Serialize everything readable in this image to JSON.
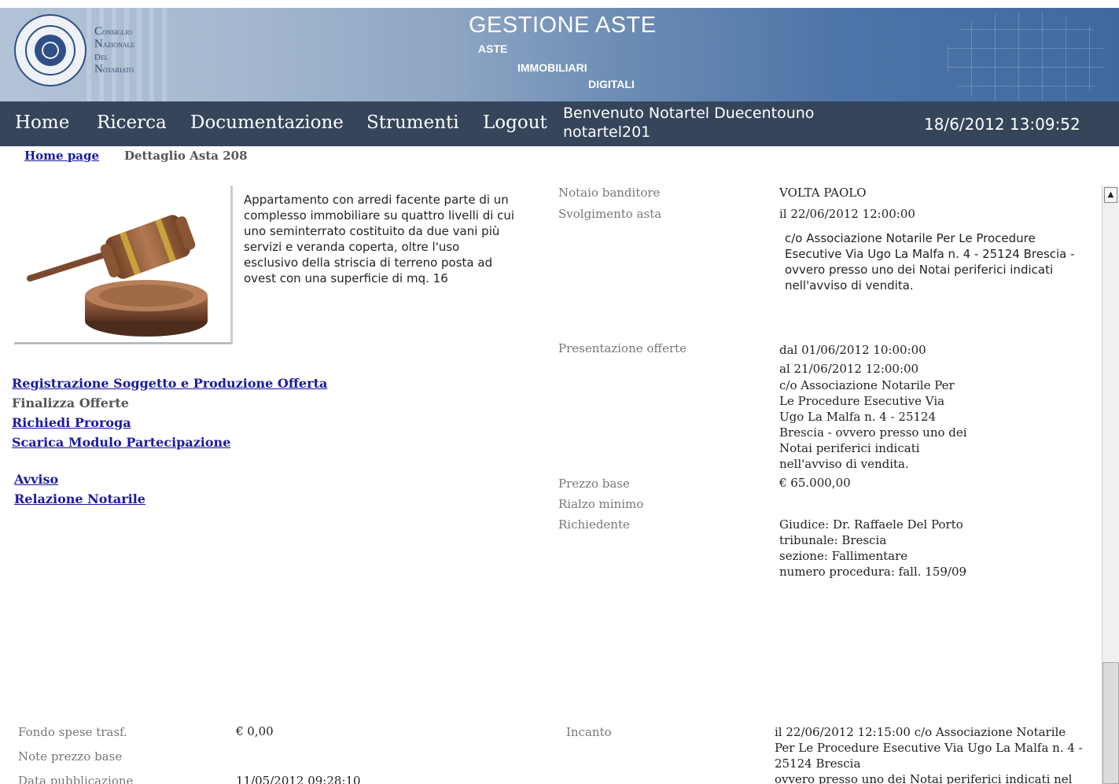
{
  "header": {
    "council": [
      "Consiglio",
      "Nazionale",
      "del",
      "Notariato"
    ],
    "title": "GESTIONE ASTE",
    "subtitle1": "ASTE",
    "subtitle2": "IMMOBILIARI",
    "subtitle3": "DIGITALI"
  },
  "nav": {
    "items": [
      {
        "label": "Home"
      },
      {
        "label": "Ricerca"
      },
      {
        "label": "Documentazione"
      },
      {
        "label": "Strumenti"
      },
      {
        "label": "Logout"
      }
    ],
    "welcome_line1": "Benvenuto Notartel Duecentouno",
    "welcome_line2": "notartel201",
    "datetime": "18/6/2012 13:09:52"
  },
  "breadcrumb": {
    "home": "Home page",
    "current": "Dettaglio Asta 208"
  },
  "listing": {
    "image_icon": "gavel-icon",
    "description": "Appartamento con arredi facente parte di un complesso immobiliare su quattro livelli di cui uno seminterrato costituito da due vani più servizi e veranda coperta, oltre l'uso esclusivo della striscia di terreno posta ad ovest con una superficie di mq. 16"
  },
  "actions": {
    "register": "Registrazione Soggetto e Produzione Offerta",
    "finalize": "Finalizza Offerte",
    "extension": "Richiedi Proroga",
    "download_form": "Scarica Modulo Partecipazione"
  },
  "documents": {
    "notice": "Avviso",
    "notary_report": "Relazione Notarile"
  },
  "details": {
    "notary_label": "Notaio banditore",
    "notary_value": "VOLTA PAOLO",
    "auction_label": "Svolgimento asta",
    "auction_date": "il 22/06/2012 12:00:00",
    "auction_place": "c/o Associazione Notarile Per Le Procedure Esecutive Via Ugo La Malfa n. 4 - 25124 Brescia - ovvero presso uno dei Notai periferici indicati nell'avviso di vendita.",
    "offers_label": "Presentazione offerte",
    "offers_from": "dal 01/06/2012 10:00:00",
    "offers_to": "al 21/06/2012 12:00:00",
    "offers_place_lines": [
      "c/o Associazione Notarile Per",
      "Le Procedure Esecutive Via",
      "Ugo La Malfa n. 4 - 25124",
      "Brescia - ovvero presso uno dei",
      "Notai periferici indicati",
      "nell'avviso di vendita."
    ],
    "base_price_label": "Prezzo base",
    "base_price_value": "€ 65.000,00",
    "min_raise_label": "Rialzo minimo",
    "requester_label": "Richiedente",
    "requester_lines": [
      "Giudice: Dr. Raffaele Del Porto",
      "tribunale: Brescia",
      "sezione: Fallimentare",
      "numero procedura: fall. 159/09"
    ]
  },
  "bottom": {
    "transfer_fund_label": "Fondo spese trasf.",
    "transfer_fund_value": "€ 0,00",
    "base_price_notes_label": "Note prezzo base",
    "publication_label": "Data pubblicazione",
    "publication_value": "11/05/2012 09:28:10",
    "incanto_label": "Incanto",
    "incanto_lines": [
      "il 22/06/2012 12:15:00 c/o Associazione Notarile",
      "Per Le Procedure Esecutive Via Ugo La Malfa n. 4 -",
      "25124 Brescia",
      "ovvero presso uno dei Notai periferici indicati nel"
    ]
  },
  "scrollbar": {
    "up_icon": "arrow-up-icon"
  }
}
